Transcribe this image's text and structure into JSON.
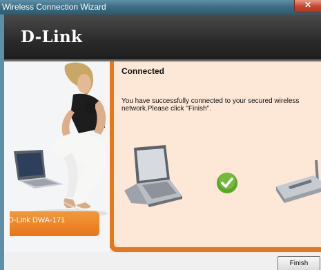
{
  "window": {
    "title": "Wireless Connection Wizard"
  },
  "banner": {
    "logo_text": "D-Link"
  },
  "sidebar": {
    "product_name": "D-Link DWA-171"
  },
  "content": {
    "heading": "Connected",
    "message": "You have successfully connected to your secured wireless network.Please click \"Finish\"."
  },
  "footer": {
    "finish_label": "Finish"
  },
  "colors": {
    "accent": "#e8761b",
    "panel": "#fde7d6",
    "banner": "#2b2b2b",
    "titlebar": "#3e6f86"
  },
  "icons": {
    "close": "close-icon",
    "laptop": "laptop-icon",
    "check": "checkmark-icon",
    "router": "router-icon"
  }
}
